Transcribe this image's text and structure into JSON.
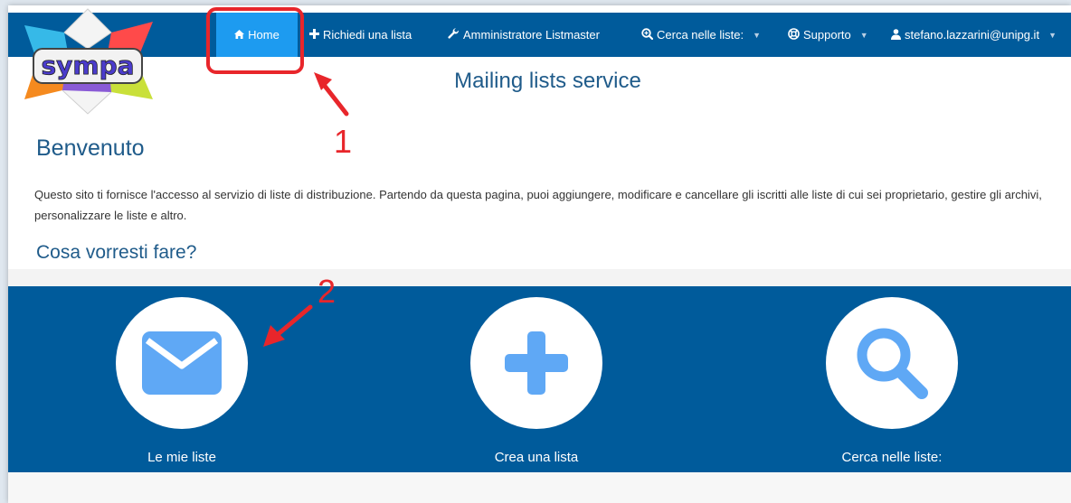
{
  "nav": {
    "items": [
      {
        "icon": "home-icon",
        "label": "Home",
        "active": true
      },
      {
        "icon": "plus-icon",
        "label": "Richiedi una lista"
      },
      {
        "icon": "wrench-icon",
        "label": "Amministratore Listmaster"
      },
      {
        "icon": "search-plus-icon",
        "label": "Cerca nelle liste:"
      },
      {
        "icon": "lifebuoy-icon",
        "label": "Supporto"
      },
      {
        "icon": "user-icon",
        "label": "stefano.lazzarini@unipg.it"
      }
    ]
  },
  "logo": {
    "text": "sympa"
  },
  "header": {
    "title": "Mailing lists service"
  },
  "main": {
    "welcome": "Benvenuto",
    "intro": "Questo sito ti fornisce l'accesso al servizio di liste di distribuzione. Partendo da questa pagina, puoi aggiungere, modificare e cancellare gli iscritti alle liste di cui sei proprietario, gestire gli archivi, personalizzare le liste e altro.",
    "question": "Cosa vorresti fare?"
  },
  "actions": [
    {
      "icon": "envelope-icon",
      "label": "Le mie liste"
    },
    {
      "icon": "plus-icon",
      "label": "Crea una lista"
    },
    {
      "icon": "search-icon",
      "label": "Cerca nelle liste:"
    }
  ],
  "annotations": {
    "step1": "1",
    "step2": "2"
  },
  "colors": {
    "navbar": "#005b9b",
    "active_tab": "#1d9bf0",
    "heading": "#1f5b8a",
    "icon": "#5fa8f5",
    "annotation": "#e8262b"
  }
}
